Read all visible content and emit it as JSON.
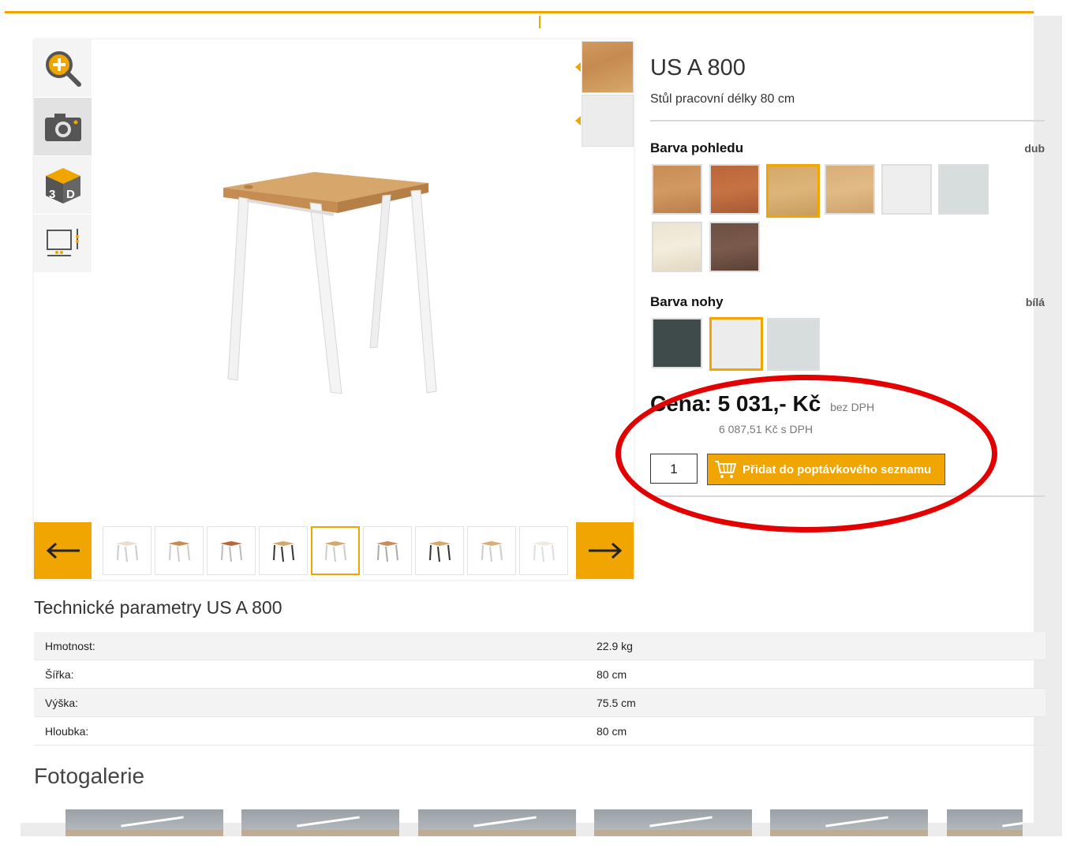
{
  "product": {
    "title": "US A 800",
    "subtitle": "Stůl pracovní délky 80 cm"
  },
  "tools": [
    {
      "icon": "zoom-in-icon"
    },
    {
      "icon": "camera-icon"
    },
    {
      "icon": "3d-icon"
    },
    {
      "icon": "dimensions-icon"
    }
  ],
  "top_color": {
    "label": "Barva pohledu",
    "value": "dub",
    "swatches": [
      "#c98c55",
      "#b9663a",
      "#d4a86a",
      "#d9ae78",
      "#eeeeee",
      "#d7dddd",
      "#ece4d2",
      "#6c4f43"
    ]
  },
  "leg_color": {
    "label": "Barva nohy",
    "value": "bílá",
    "swatches": [
      "#3f4a4a",
      "#ececec",
      "#d7dddd"
    ]
  },
  "price": {
    "main": "Cena: 5 031,- Kč",
    "suffix": "bez DPH",
    "with_vat": "6 087,51 Kč s DPH"
  },
  "cart": {
    "quantity": "1",
    "add_label": "Přidat do poptávkového seznamu"
  },
  "tech": {
    "title": "Technické parametry US A 800",
    "rows": [
      {
        "label": "Hmotnost:",
        "value": "22.9 kg"
      },
      {
        "label": "Šířka:",
        "value": "80 cm"
      },
      {
        "label": "Výška:",
        "value": "75.5 cm"
      },
      {
        "label": "Hloubka:",
        "value": "80 cm"
      }
    ]
  },
  "gallery": {
    "title": "Fotogalerie"
  },
  "colors": {
    "accent": "#f0a500",
    "highlight": "#e30000"
  }
}
